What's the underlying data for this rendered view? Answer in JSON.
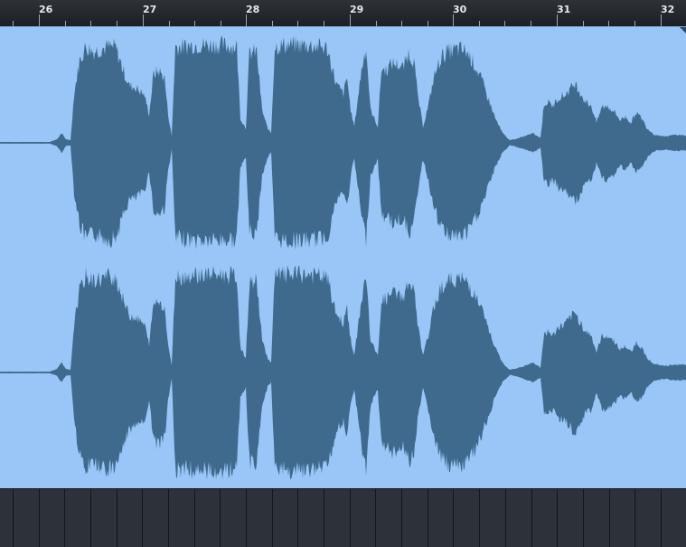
{
  "ruler": {
    "bars": [
      "26",
      "27",
      "28",
      "29",
      "30",
      "31",
      "32"
    ]
  },
  "colors": {
    "ruler_text": "#e6e8eb",
    "event_background": "#99c6f7",
    "waveform": "#3f6a8d",
    "lane_background": "#2d3139"
  }
}
